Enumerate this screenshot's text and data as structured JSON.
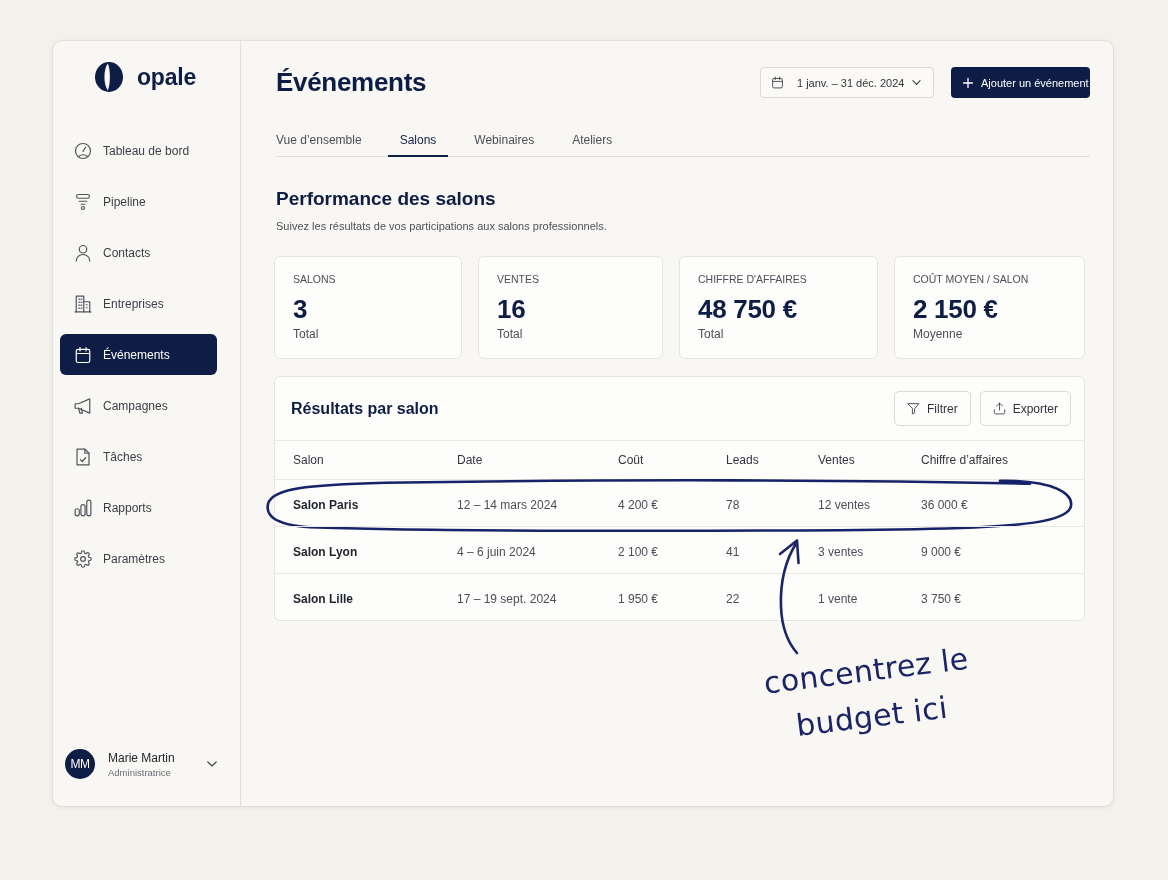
{
  "sidebar": {
    "logo": "opale",
    "nav_items": [
      {
        "label": "Tableau de bord",
        "selected": false
      },
      {
        "label": "Pipeline",
        "selected": false
      },
      {
        "label": "Contacts",
        "selected": false
      },
      {
        "label": "Entreprises",
        "selected": false
      },
      {
        "label": "Événements",
        "selected": true
      },
      {
        "label": "Campagnes",
        "selected": false
      },
      {
        "label": "Tâches",
        "selected": false
      },
      {
        "label": "Rapports",
        "selected": false
      },
      {
        "label": "Paramètres",
        "selected": false
      }
    ],
    "user": {
      "initials": "MM",
      "name": "Marie Martin",
      "role": "Administratrice"
    }
  },
  "header": {
    "title": "Événements",
    "date_range": "1 janv. – 31 déc. 2024",
    "add_button": "Ajouter un événement"
  },
  "tabs": [
    {
      "label": "Vue d’ensemble",
      "selected": false
    },
    {
      "label": "Salons",
      "selected": true
    },
    {
      "label": "Webinaires",
      "selected": false
    },
    {
      "label": "Ateliers",
      "selected": false
    }
  ],
  "section": {
    "title": "Performance des salons",
    "subtitle": "Suivez les résultats de vos participations aux salons professionnels."
  },
  "kpis": [
    {
      "label": "SALONS",
      "value": "3",
      "caption": "Total"
    },
    {
      "label": "VENTES",
      "value": "16",
      "caption": "Total"
    },
    {
      "label": "CHIFFRE D'AFFAIRES",
      "value": "48 750 €",
      "caption": "Total"
    },
    {
      "label": "COÛT MOYEN / SALON",
      "value": "2 150 €",
      "caption": "Moyenne"
    }
  ],
  "results": {
    "title": "Résultats par salon",
    "buttons": [
      "Filtrer",
      "Exporter"
    ],
    "columns": [
      "Salon",
      "Date",
      "Coût",
      "Leads",
      "Ventes",
      "Chiffre d’affaires"
    ],
    "rows": [
      {
        "cells": [
          "Salon Paris",
          "12 – 14 mars 2024",
          "4 200 €",
          "78",
          "12 ventes",
          "36 000 €"
        ],
        "circled": true
      },
      {
        "cells": [
          "Salon Lyon",
          "4 – 6 juin 2024",
          "2 100 €",
          "41",
          "3 ventes",
          "9 000 €"
        ],
        "circled": false
      },
      {
        "cells": [
          "Salon Lille",
          "17 – 19 sept. 2024",
          "1 950 €",
          "22",
          "1 vente",
          "3 750 €"
        ],
        "circled": false
      }
    ]
  },
  "annotation": {
    "note": "concentrez le budget ici"
  }
}
